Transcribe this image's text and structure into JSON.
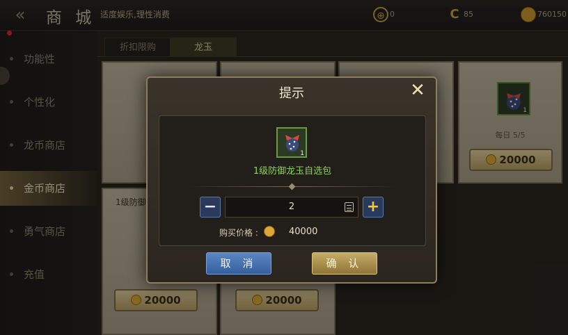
{
  "header": {
    "back_icon": "back-arrow-icon",
    "title": "商 城",
    "subtitle": "适度娱乐,理性消费",
    "resources": [
      {
        "icon": "target-icon",
        "value": "0"
      },
      {
        "icon": "c-currency-icon",
        "value": "85"
      },
      {
        "icon": "gold-coin-icon",
        "value": "760150"
      }
    ]
  },
  "sidebar": {
    "items": [
      {
        "label": "功能性"
      },
      {
        "label": "个性化"
      },
      {
        "label": "龙币商店"
      },
      {
        "label": "金币商店"
      },
      {
        "label": "勇气商店"
      },
      {
        "label": "充值"
      }
    ],
    "active_index": 3
  },
  "shop": {
    "tabs": [
      {
        "label": "折扣限购"
      },
      {
        "label": "龙玉"
      }
    ],
    "active_tab": 1,
    "cards": [
      {
        "daily": "每日 5/5",
        "price": "20000",
        "count": "1"
      },
      {
        "name": "1级防御",
        "price": "20000"
      },
      {
        "price": "20000"
      }
    ]
  },
  "dialog": {
    "title": "提示",
    "item_name": "1级防御龙玉自选包",
    "item_count": "1",
    "quantity": "2",
    "price_label": "购买价格 :",
    "price_value": "40000",
    "cancel_label": "取 消",
    "confirm_label": "确 认"
  },
  "colors": {
    "accent_gold": "#d8a838",
    "item_name_green": "#8ed05a",
    "cancel_blue": "#3e6aa8",
    "confirm_gold": "#a88c48"
  }
}
